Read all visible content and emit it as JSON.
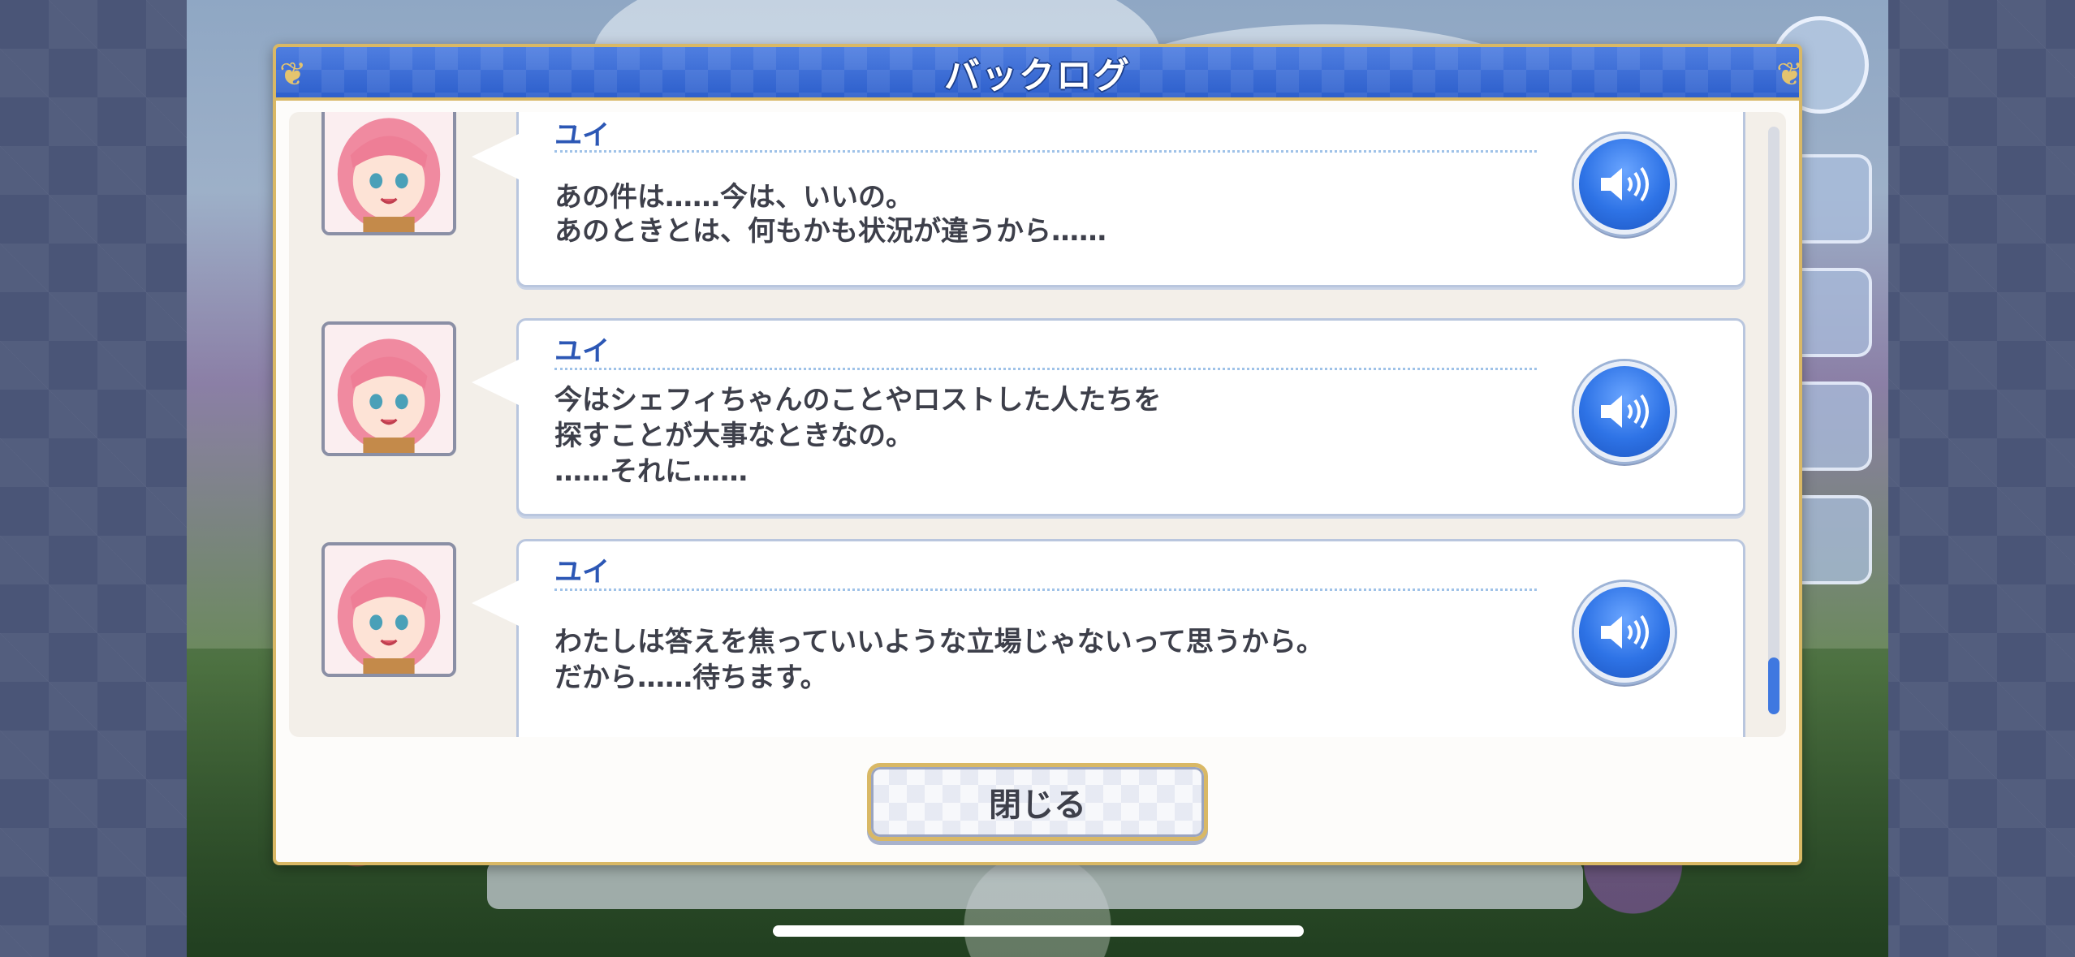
{
  "modal": {
    "title": "バックログ",
    "close_label": "閉じる"
  },
  "entries": [
    {
      "speaker": "ユイ",
      "lines": [
        "あの件は……今は、いいの。",
        "あのときとは、何もかも状況が違うから……"
      ]
    },
    {
      "speaker": "ユイ",
      "lines": [
        "今はシェフィちゃんのことやロストした人たちを",
        "探すことが大事なときなの。",
        "……それに……"
      ]
    },
    {
      "speaker": "ユイ",
      "lines": [
        "わたしは答えを焦っていいような立場じゃないって思うから。",
        "だから……待ちます。"
      ]
    }
  ],
  "icons": {
    "voice": "speaker-volume-icon",
    "avatar": "character-portrait",
    "menu": "hamburger-menu-icon"
  },
  "colors": {
    "header_blue": "#2d5fcc",
    "gold_border": "#d9b865",
    "speaker_name": "#2c57b5",
    "scroll_thumb": "#3f78e0"
  }
}
